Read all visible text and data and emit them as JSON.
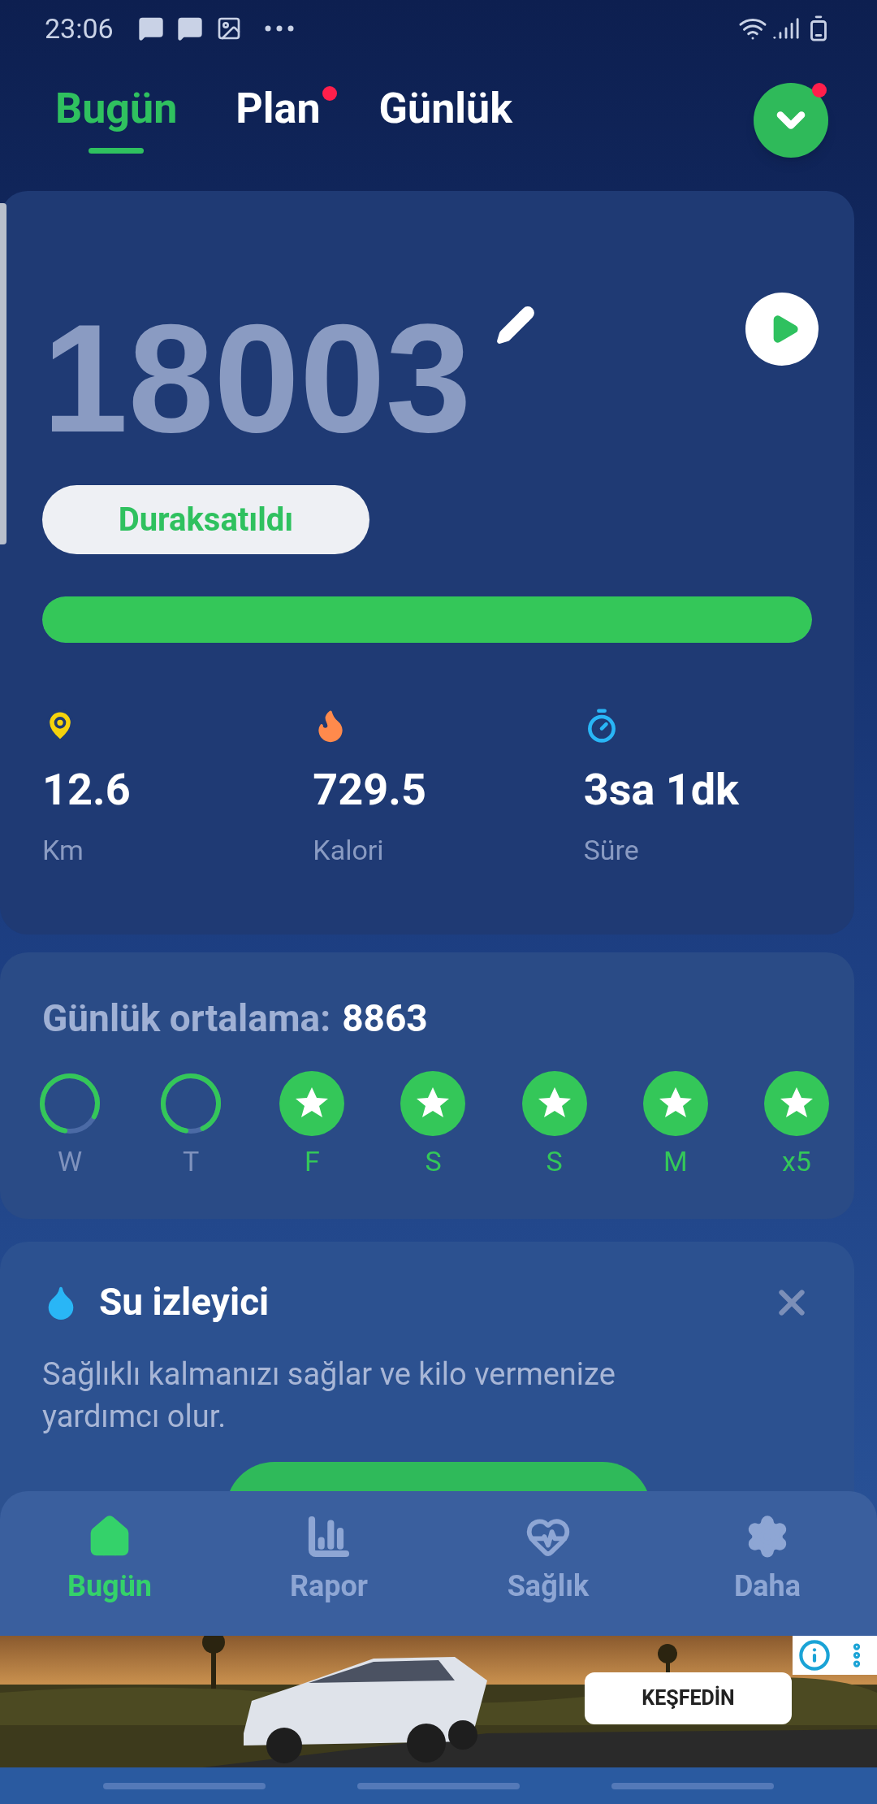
{
  "status_bar": {
    "time": "23:06"
  },
  "tabs": [
    {
      "label": "Bugün",
      "selected": true,
      "badge": false
    },
    {
      "label": "Plan",
      "selected": false,
      "badge": true
    },
    {
      "label": "Günlük",
      "selected": false,
      "badge": false
    }
  ],
  "menu_button": {
    "badge": true
  },
  "steps": {
    "count": "18003",
    "status": "Duraksatıldı",
    "level": 1
  },
  "stats": [
    {
      "kind": "distance",
      "value": "12.6",
      "label": "Km"
    },
    {
      "kind": "calories",
      "value": "729.5",
      "label": "Kalori"
    },
    {
      "kind": "time",
      "value": "3sa 1dk",
      "label": "Süre"
    }
  ],
  "daily_average": {
    "label": "Günlük ortalama:",
    "value": "8863"
  },
  "week": [
    {
      "kind": "ring",
      "level": 0.8,
      "label": "W"
    },
    {
      "kind": "ring",
      "level": 0.9,
      "label": "T"
    },
    {
      "kind": "star",
      "label": "F"
    },
    {
      "kind": "star",
      "label": "S"
    },
    {
      "kind": "star",
      "label": "S"
    },
    {
      "kind": "star",
      "label": "M"
    },
    {
      "kind": "star",
      "label": "x5"
    }
  ],
  "water_card": {
    "title": "Su izleyici",
    "text": "Sağlıklı kalmanızı sağlar ve kilo vermenize yardımcı olur."
  },
  "bottom_nav": [
    {
      "kind": "home",
      "label": "Bugün",
      "selected": true
    },
    {
      "kind": "report",
      "label": "Rapor",
      "selected": false
    },
    {
      "kind": "health",
      "label": "Sağlık",
      "selected": false
    },
    {
      "kind": "more",
      "label": "Daha",
      "selected": false
    }
  ],
  "ad": {
    "kind": "picture",
    "button": "KEŞFEDİN"
  }
}
